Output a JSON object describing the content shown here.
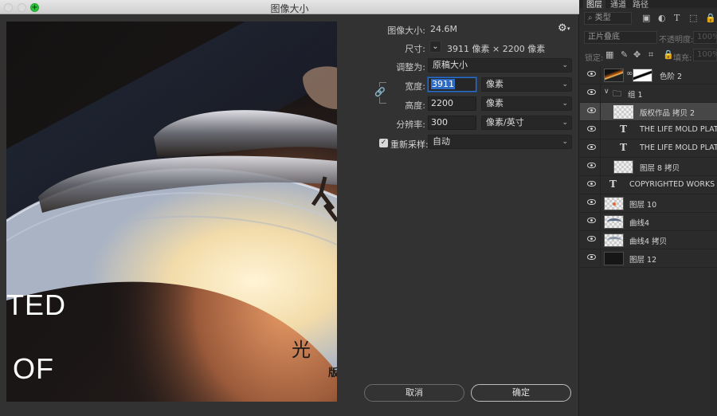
{
  "window": {
    "title": "图像大小"
  },
  "preview": {
    "text_ted": "TED",
    "text_of": "OF",
    "text_guang": "光",
    "text_ban": "版"
  },
  "form": {
    "image_size_label": "图像大小:",
    "image_size_value": "24.6M",
    "dimensions_label": "尺寸:",
    "dimensions_value": "3911 像素  ×  2200 像素",
    "fit_to_label": "调整为:",
    "fit_to_value": "原稿大小",
    "width_label": "宽度:",
    "width_value": "3911",
    "width_unit": "像素",
    "height_label": "高度:",
    "height_value": "2200",
    "height_unit": "像素",
    "resolution_label": "分辨率:",
    "resolution_value": "300",
    "resolution_unit": "像素/英寸",
    "resample_label": "重新采样:",
    "resample_checked": true,
    "resample_value": "自动",
    "constrain_proportions": true
  },
  "buttons": {
    "cancel": "取消",
    "ok": "确定"
  },
  "layers_panel": {
    "tabs": [
      "图层",
      "通道",
      "路径"
    ],
    "active_tab": "图层",
    "filter_placeholder": "类型",
    "blend_mode": "正片叠底",
    "opacity_label": "不透明度:",
    "opacity_value": "100%",
    "lock_label": "锁定:",
    "fill_label": "填充:",
    "fill_value": "100%",
    "layers": [
      {
        "name": "色阶 2",
        "type": "adjustment",
        "visible": true
      },
      {
        "name": "组 1",
        "type": "group",
        "visible": true,
        "expanded": true
      },
      {
        "name": "版权作品 拷贝 2",
        "type": "pixel",
        "visible": true,
        "selected": true
      },
      {
        "name": "THE LIFE MOLD PLATE",
        "type": "text",
        "visible": true
      },
      {
        "name": "THE LIFE MOLD PLATE",
        "type": "text",
        "visible": true
      },
      {
        "name": "图层 8 拷贝",
        "type": "pixel",
        "visible": true
      },
      {
        "name": "COPYRIGHTED WORKS OF",
        "type": "text",
        "visible": true
      },
      {
        "name": "图层 10",
        "type": "pixel",
        "visible": true
      },
      {
        "name": "曲线4",
        "type": "pixel",
        "visible": true
      },
      {
        "name": "曲线4 拷贝",
        "type": "pixel",
        "visible": true
      },
      {
        "name": "图层 12",
        "type": "pixel",
        "visible": true
      }
    ]
  }
}
